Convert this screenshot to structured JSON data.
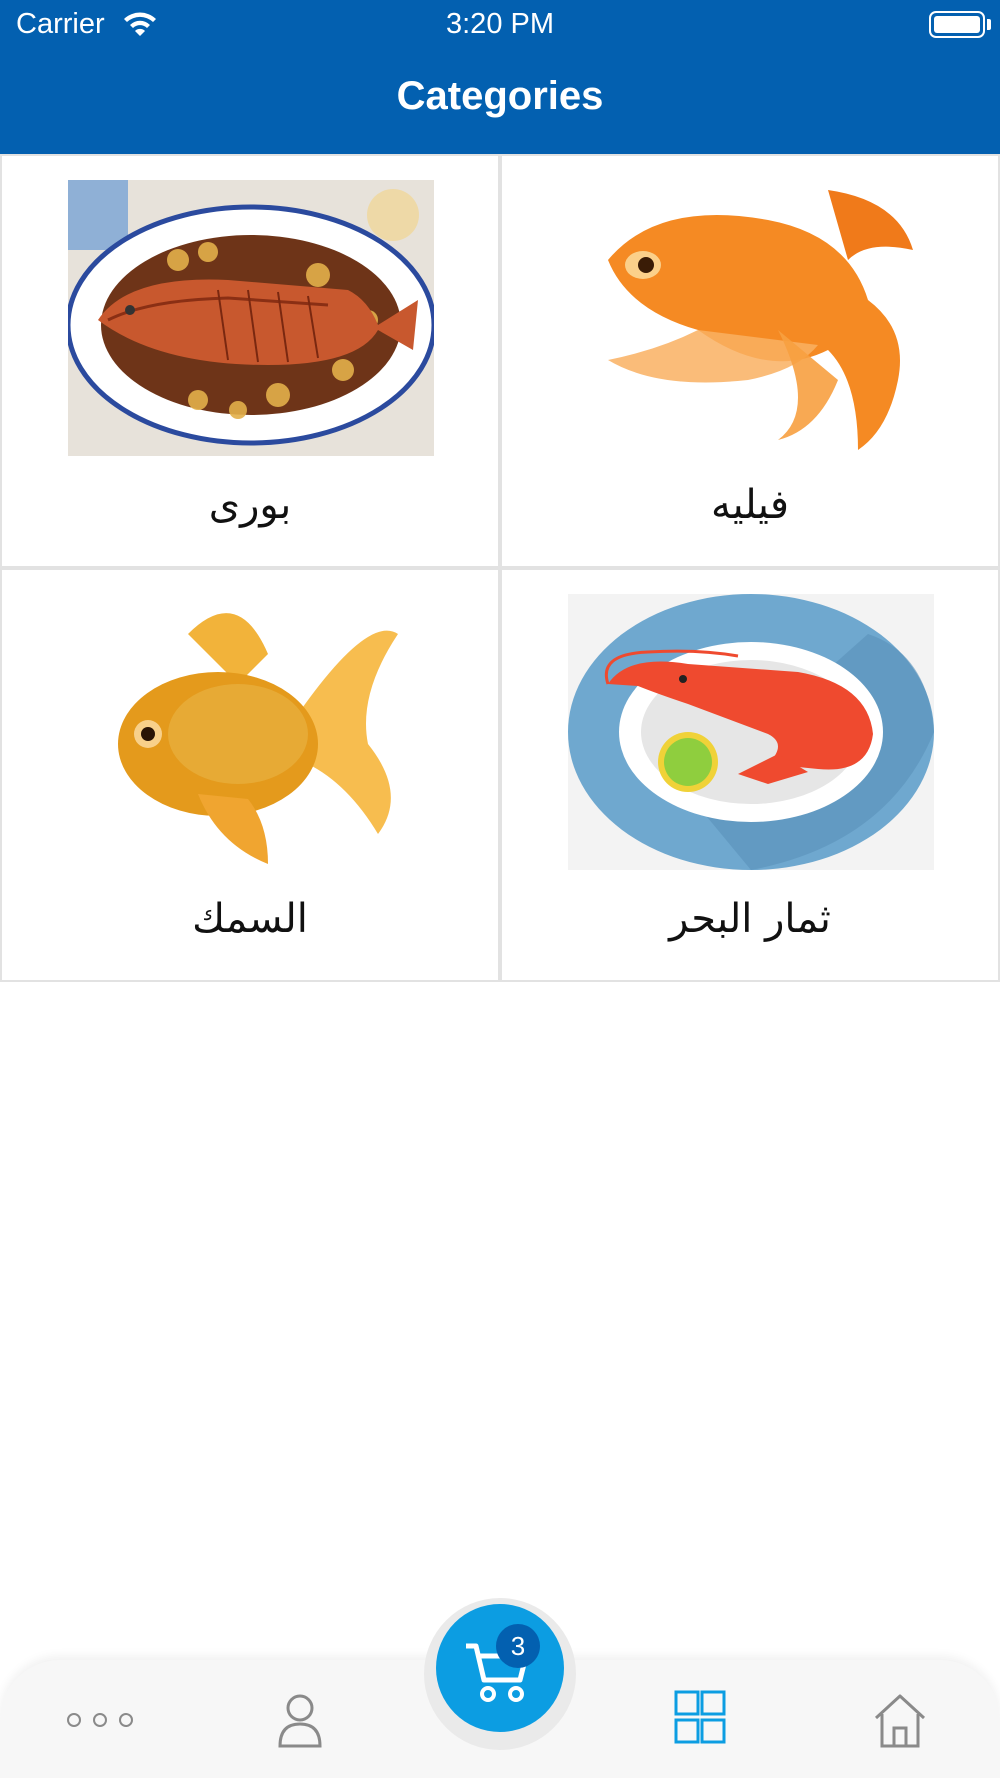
{
  "status_bar": {
    "carrier": "Carrier",
    "time": "3:20 PM"
  },
  "header": {
    "title": "Categories"
  },
  "categories": [
    {
      "label": "بورى",
      "image": "grilled-fish-plate-image"
    },
    {
      "label": "فيليه",
      "image": "orange-fish-image"
    },
    {
      "label": "السمك",
      "image": "goldfish-image"
    },
    {
      "label": "ثمار البحر",
      "image": "shrimp-plate-image"
    }
  ],
  "tab_bar": {
    "cart_badge": "3",
    "active_tab": "categories",
    "accent_color": "#0c9de2",
    "brand_color": "#0360b0"
  }
}
